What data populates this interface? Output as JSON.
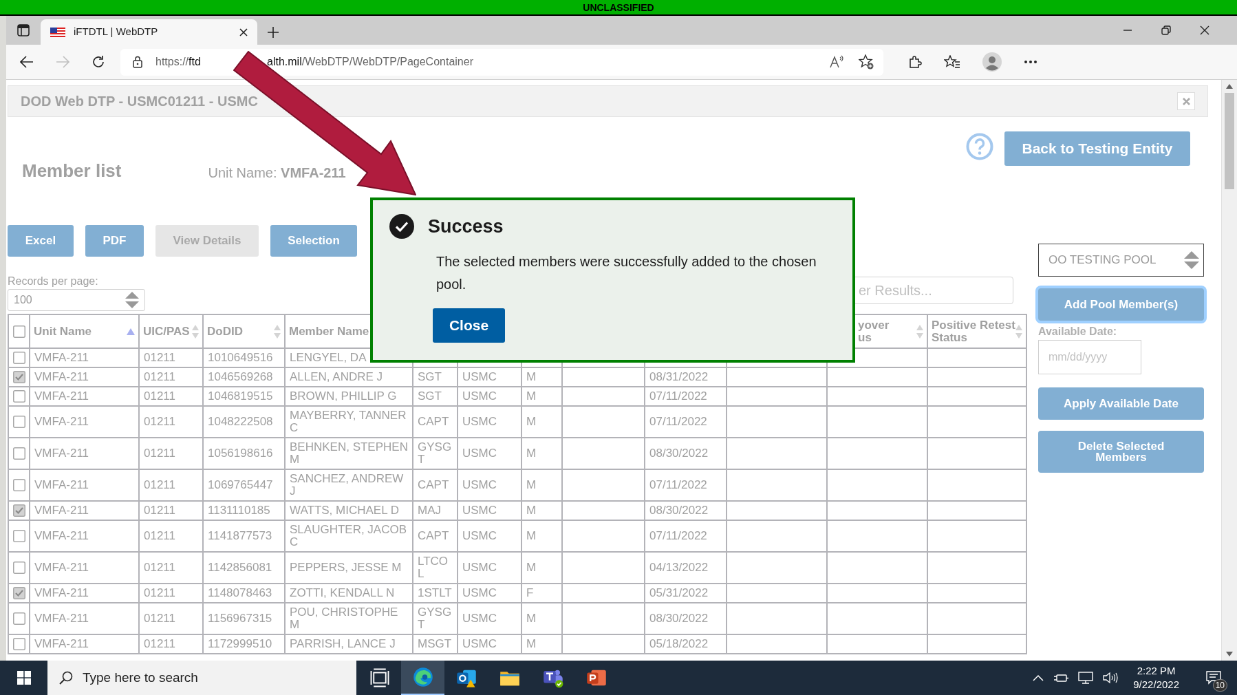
{
  "banner": "UNCLASSIFIED",
  "browser": {
    "tabs": [
      {
        "title": "iFTDTL | WebDTP",
        "selected": true
      }
    ],
    "forward_disabled": true,
    "url": {
      "scheme": "https://",
      "host_start": "ftd",
      "host_end": "alth.mil",
      "path": "/WebDTP/WebDTP/PageContainer"
    }
  },
  "page": {
    "title": "DOD Web DTP - USMC01211 - USMC",
    "heading": "Member list",
    "unit_label": "Unit Name:",
    "unit_value": "VMFA-211",
    "back_button": "Back to Testing Entity",
    "actions": [
      {
        "label": "Excel",
        "disabled": false
      },
      {
        "label": "PDF",
        "disabled": false
      },
      {
        "label": "View Details",
        "disabled": true
      },
      {
        "label": "Selection",
        "disabled": false
      }
    ],
    "records_label": "Records per page:",
    "records_value": "100",
    "filter_placeholder": "er Results...",
    "table": {
      "select_all_checked": false,
      "header_left": [
        {
          "label": "Unit Name",
          "sorted_ascending": true
        },
        {
          "label": "UIC/PAS",
          "sorted_ascending": false
        },
        {
          "label": "DoDID",
          "sorted_ascending": false
        },
        {
          "label": "Member Name"
        }
      ],
      "header_right": [
        {
          "lines": [
            "yover",
            "us"
          ],
          "sorted_ascending": false
        },
        {
          "lines": [
            "Positive Retest",
            "Status"
          ],
          "sorted_ascending": false
        }
      ],
      "rows": [
        {
          "checked": false,
          "unit": "VMFA-211",
          "uic": "01211",
          "dodid": "1010649516",
          "name": "LENGYEL, DA"
        },
        {
          "checked": true,
          "unit": "VMFA-211",
          "uic": "01211",
          "dodid": "1046569268",
          "name": "ALLEN, ANDRE J",
          "rank": "SGT",
          "branch": "USMC",
          "gender": "M",
          "date": "08/31/2022"
        },
        {
          "checked": false,
          "unit": "VMFA-211",
          "uic": "01211",
          "dodid": "1046819515",
          "name": "BROWN, PHILLIP G",
          "rank": "SGT",
          "branch": "USMC",
          "gender": "M",
          "date": "07/11/2022"
        },
        {
          "checked": false,
          "unit": "VMFA-211",
          "uic": "01211",
          "dodid": "1048222508",
          "name": "MAYBERRY, TANNER C",
          "rank": "CAPT",
          "branch": "USMC",
          "gender": "M",
          "date": "07/11/2022"
        },
        {
          "checked": false,
          "unit": "VMFA-211",
          "uic": "01211",
          "dodid": "1056198616",
          "name": "BEHNKEN, STEPHEN M",
          "rank": "GYSGT",
          "branch": "USMC",
          "gender": "M",
          "date": "08/30/2022"
        },
        {
          "checked": false,
          "unit": "VMFA-211",
          "uic": "01211",
          "dodid": "1069765447",
          "name": "SANCHEZ, ANDREW J",
          "rank": "CAPT",
          "branch": "USMC",
          "gender": "M",
          "date": "07/11/2022"
        },
        {
          "checked": true,
          "unit": "VMFA-211",
          "uic": "01211",
          "dodid": "1131110185",
          "name": "WATTS, MICHAEL D",
          "rank": "MAJ",
          "branch": "USMC",
          "gender": "M",
          "date": "08/30/2022"
        },
        {
          "checked": false,
          "unit": "VMFA-211",
          "uic": "01211",
          "dodid": "1141877573",
          "name": "SLAUGHTER, JACOB C",
          "rank": "CAPT",
          "branch": "USMC",
          "gender": "M",
          "date": "07/11/2022"
        },
        {
          "checked": false,
          "unit": "VMFA-211",
          "uic": "01211",
          "dodid": "1142856081",
          "name": "PEPPERS, JESSE M",
          "rank": "LTCOL",
          "branch": "USMC",
          "gender": "M",
          "date": "04/13/2022"
        },
        {
          "checked": true,
          "unit": "VMFA-211",
          "uic": "01211",
          "dodid": "1148078463",
          "name": "ZOTTI, KENDALL N",
          "rank": "1STLT",
          "branch": "USMC",
          "gender": "F",
          "date": "05/31/2022"
        },
        {
          "checked": false,
          "unit": "VMFA-211",
          "uic": "01211",
          "dodid": "1156967315",
          "name": "POU, CHRISTOPHE M",
          "rank": "GYSGT",
          "branch": "USMC",
          "gender": "M",
          "date": "08/30/2022"
        },
        {
          "checked": false,
          "unit": "VMFA-211",
          "uic": "01211",
          "dodid": "1172999510",
          "name": "PARRISH, LANCE J",
          "rank": "MSGT",
          "branch": "USMC",
          "gender": "M",
          "date": "05/18/2022"
        }
      ]
    },
    "side_panel": {
      "pool": "OO TESTING POOL",
      "add_button": {
        "label": "Add Pool Member(s)",
        "focused": true
      },
      "date_label": "Available Date:",
      "date_placeholder": "mm/dd/yyyy",
      "apply_button": "Apply Available Date",
      "delete_button": "Delete Selected Members"
    }
  },
  "dialog": {
    "title": "Success",
    "message": "The selected members were successfully added to the chosen pool.",
    "button": "Close"
  },
  "taskbar": {
    "search_placeholder": "Type here to search",
    "apps": [
      {
        "kind": "taskview",
        "active": false
      },
      {
        "kind": "edge",
        "active": true
      },
      {
        "kind": "outlook",
        "active": false
      },
      {
        "kind": "explorer",
        "active": false
      },
      {
        "kind": "teams",
        "active": false
      },
      {
        "kind": "powerpoint",
        "active": false
      }
    ],
    "time": "2:22 PM",
    "date": "9/22/2022",
    "notifications": "10"
  }
}
